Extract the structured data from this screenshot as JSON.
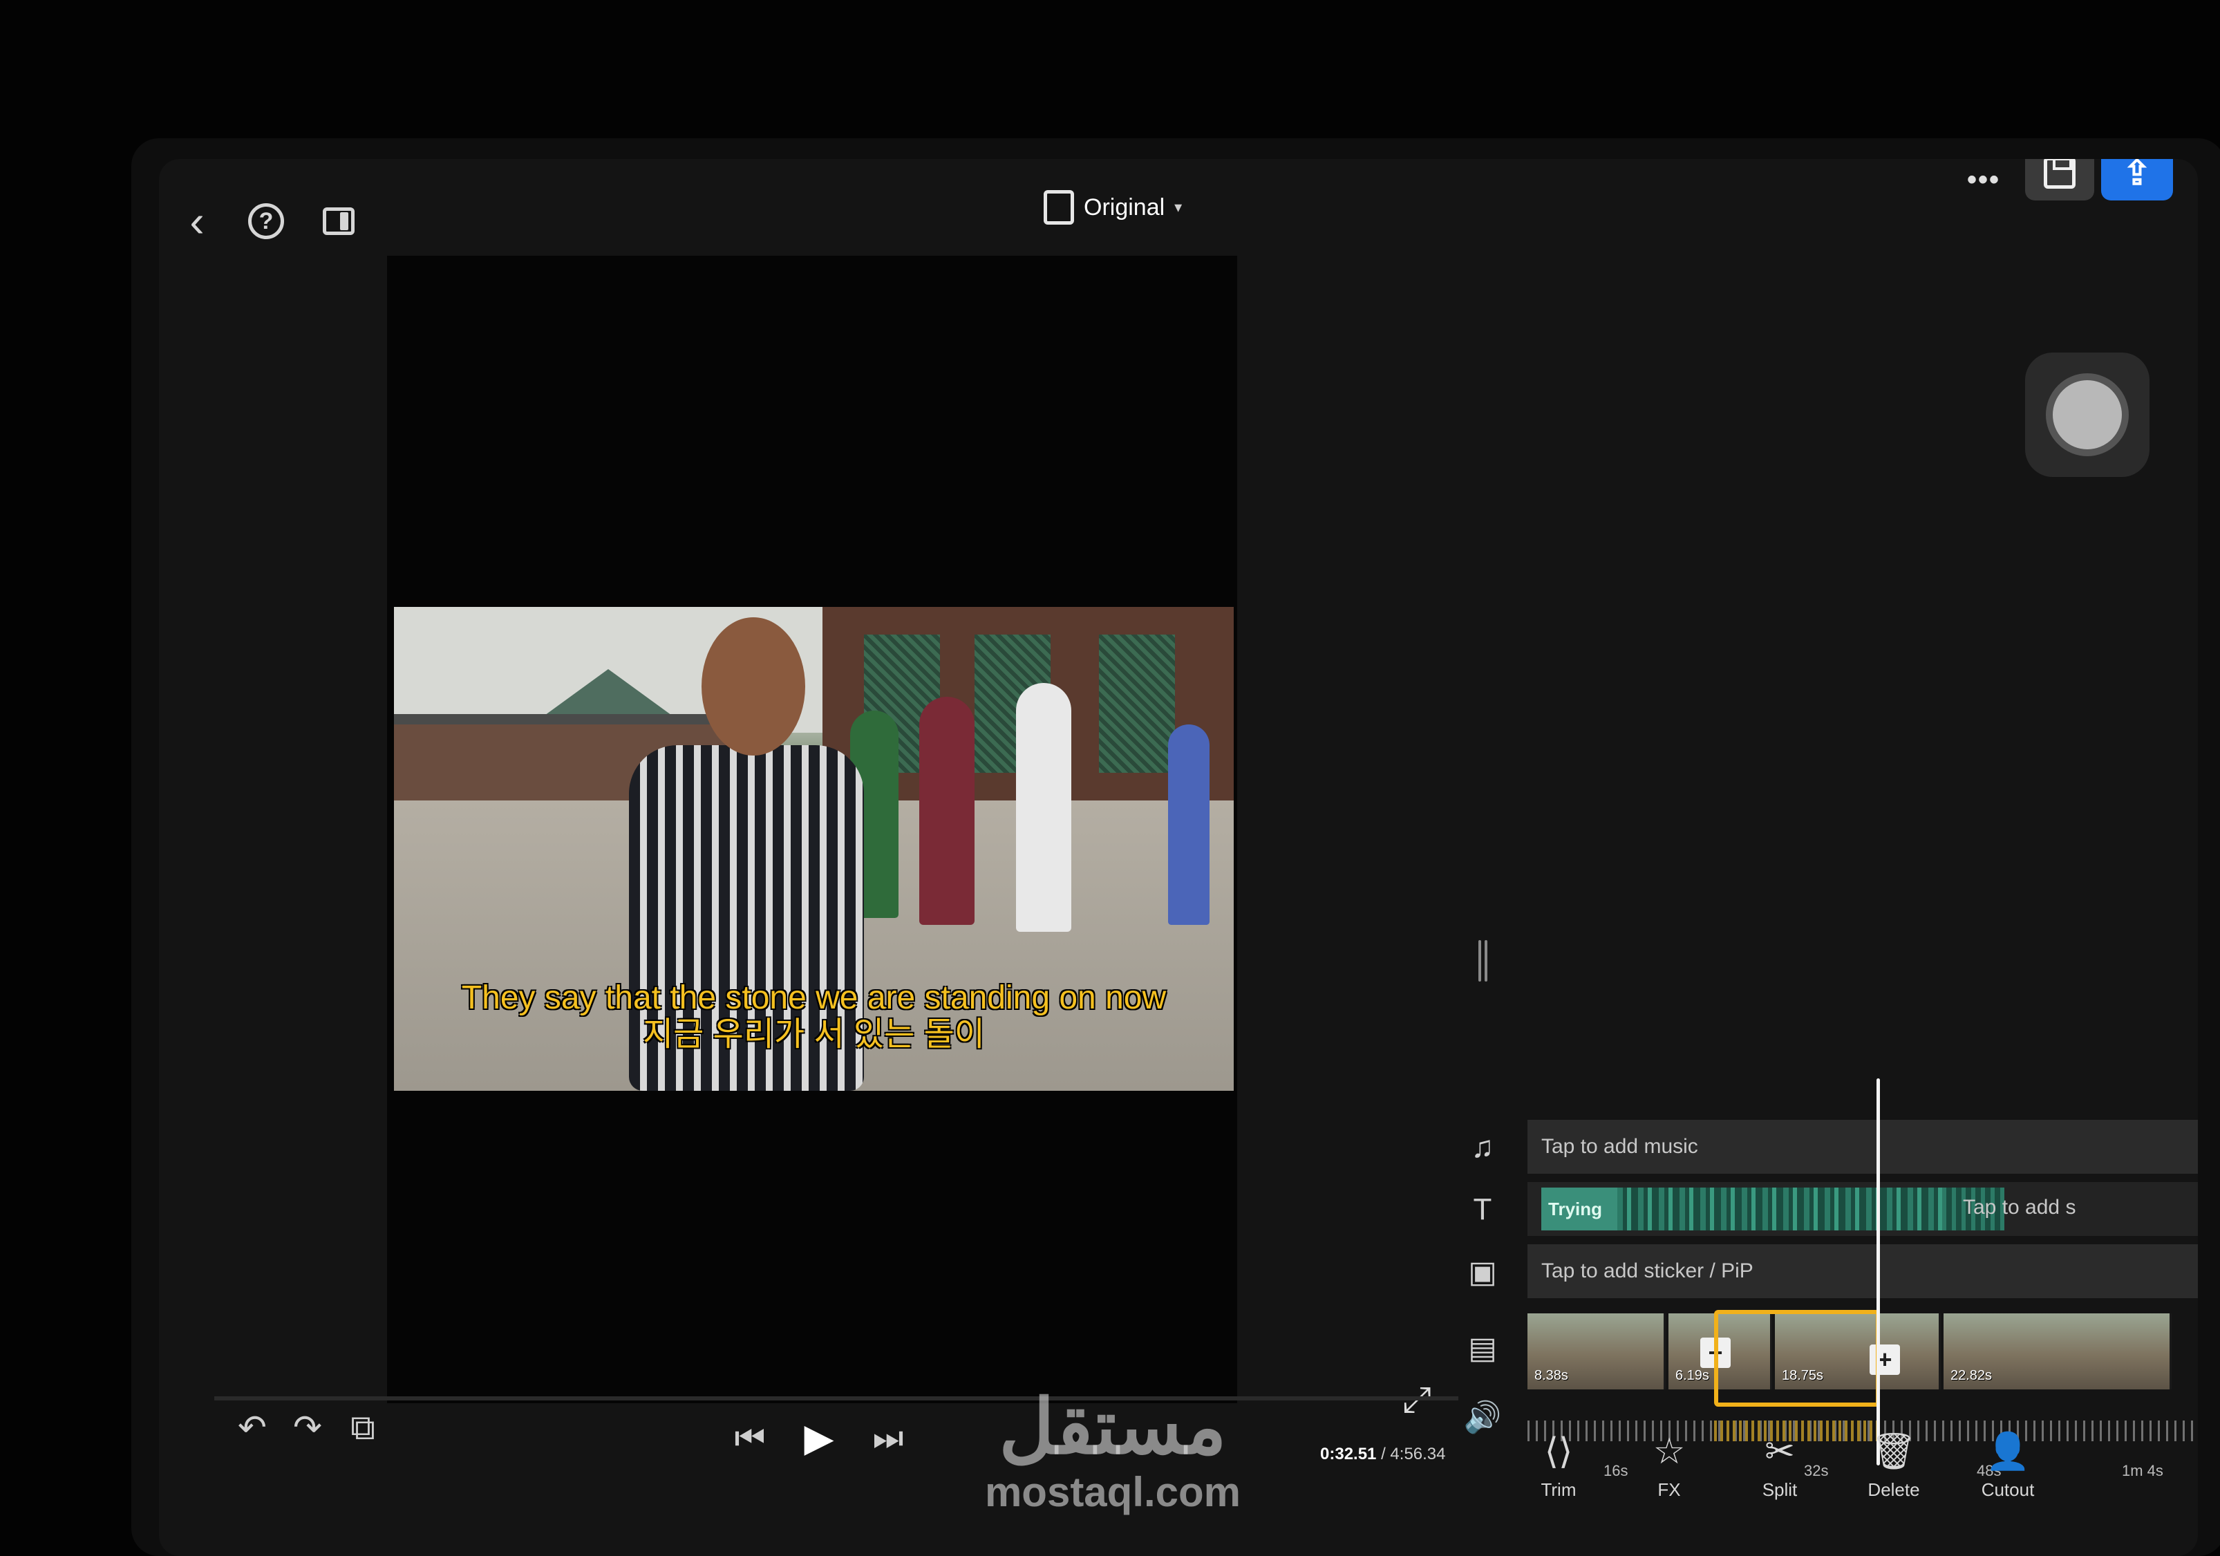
{
  "toolbar": {
    "back_icon": "chevron-left-icon",
    "help_icon": "question-circle-icon",
    "layout_icon": "panel-layout-icon",
    "ratio_label": "Original",
    "ratio_caret": "▾",
    "more_icon": "ellipsis-icon",
    "more_glyph": "•••",
    "save_icon": "floppy-disk-icon",
    "export_icon": "share-upload-icon",
    "export_glyph": "⇪"
  },
  "preview": {
    "subtitle_line1": "They say that the stone we are standing on now",
    "subtitle_line2": "지금 우리가 서 있는 돌이",
    "fullscreen_glyph": "⤢"
  },
  "playback": {
    "undo_glyph": "↶",
    "redo_glyph": "↷",
    "compare_glyph": "⧉",
    "prev_glyph": "⏮",
    "play_glyph": "▶",
    "next_glyph": "⏭",
    "current_time": "0:32.51",
    "separator": " / ",
    "total_time": "4:56.34"
  },
  "timeline": {
    "music_hint": "Tap to add music",
    "text_clip_label": "Trying",
    "text_hint": "Tap to add s",
    "sticker_hint": "Tap to add sticker / PiP",
    "clip_durations": [
      "8.38s",
      "6.19s",
      "18.75s",
      "22.82s"
    ],
    "ruler_labels": [
      "16s",
      "32s",
      "48s",
      "1m 4s"
    ],
    "icons": {
      "music": "music-add-icon",
      "text": "text-add-icon",
      "sticker": "sticker-add-icon",
      "video": "video-add-icon",
      "volume": "volume-icon"
    }
  },
  "tools": [
    {
      "label": "Trim",
      "icon": "trim-icon",
      "glyph": "⟨⟩"
    },
    {
      "label": "FX",
      "icon": "star-fx-icon",
      "glyph": "☆"
    },
    {
      "label": "Split",
      "icon": "scissors-icon",
      "glyph": "✂"
    },
    {
      "label": "Delete",
      "icon": "trash-icon",
      "glyph": "🗑"
    },
    {
      "label": "Cutout",
      "icon": "person-cutout-icon",
      "glyph": "👤"
    }
  ],
  "watermark": {
    "arabic": "مستقل",
    "latin": "mostaql.com"
  },
  "colors": {
    "accent_blue": "#1f73e8",
    "selection_gold": "#f1b11a",
    "text_track_teal": "#3a8f7a",
    "subtitle_yellow": "#f5c020"
  }
}
